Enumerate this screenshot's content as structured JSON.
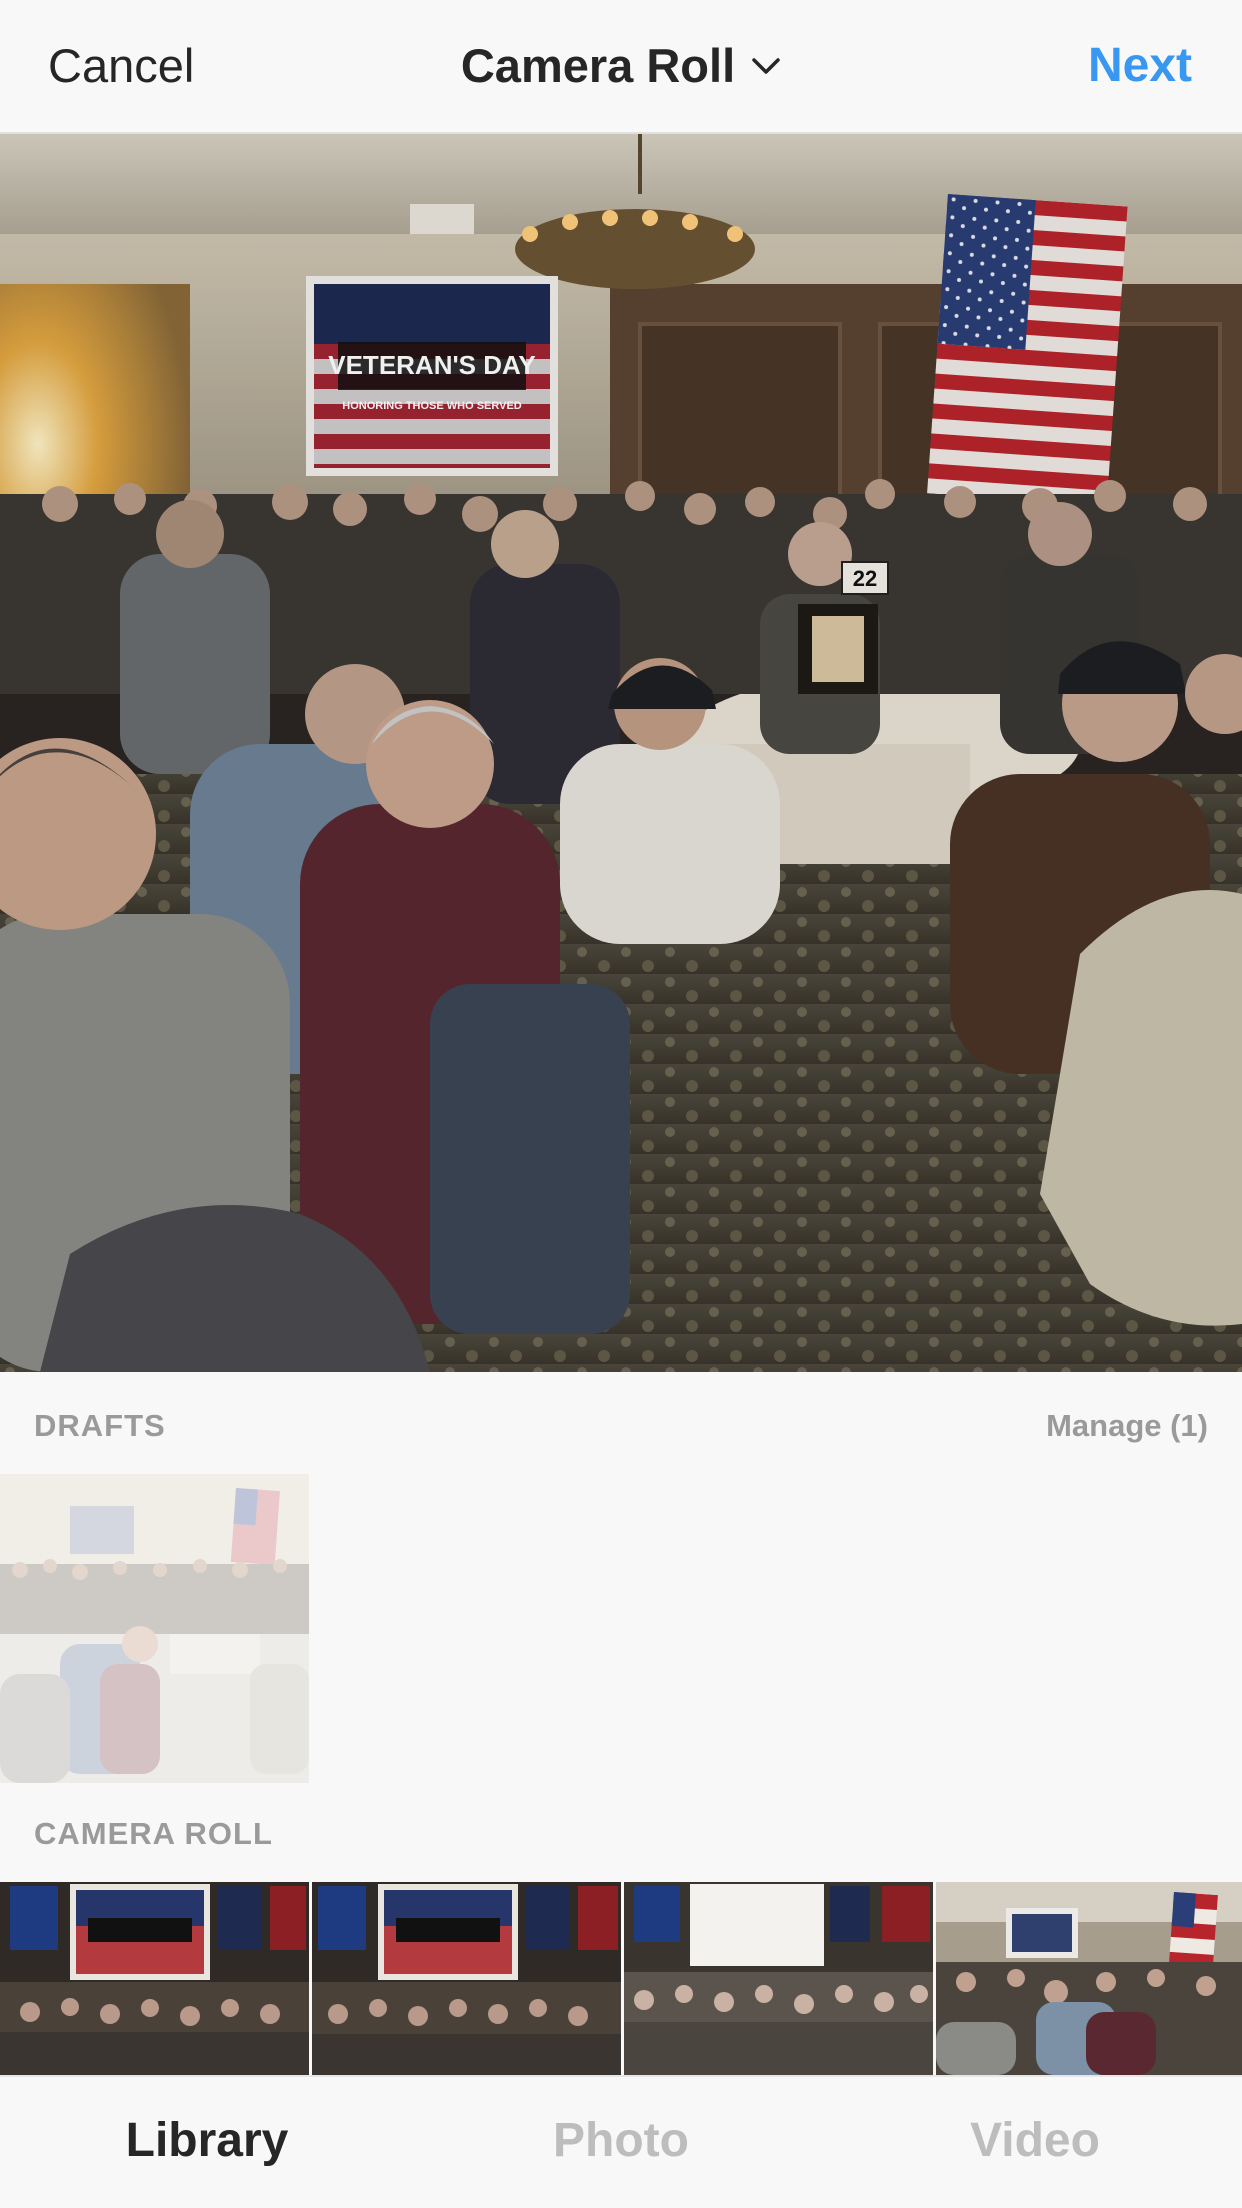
{
  "header": {
    "cancel_label": "Cancel",
    "album_title": "Camera Roll",
    "album_icon": "chevron-down-icon",
    "next_label": "Next",
    "accent_color": "#3897f0"
  },
  "preview": {
    "screen_title": "VETERAN'S DAY",
    "screen_subtitle": "HONORING THOSE WHO SERVED",
    "table_number": "22"
  },
  "drafts": {
    "label": "DRAFTS",
    "manage_label": "Manage (1)"
  },
  "camera_roll": {
    "label": "CAMERA ROLL"
  },
  "tabs": [
    {
      "label": "Library",
      "active": true
    },
    {
      "label": "Photo",
      "active": false
    },
    {
      "label": "Video",
      "active": false
    }
  ]
}
